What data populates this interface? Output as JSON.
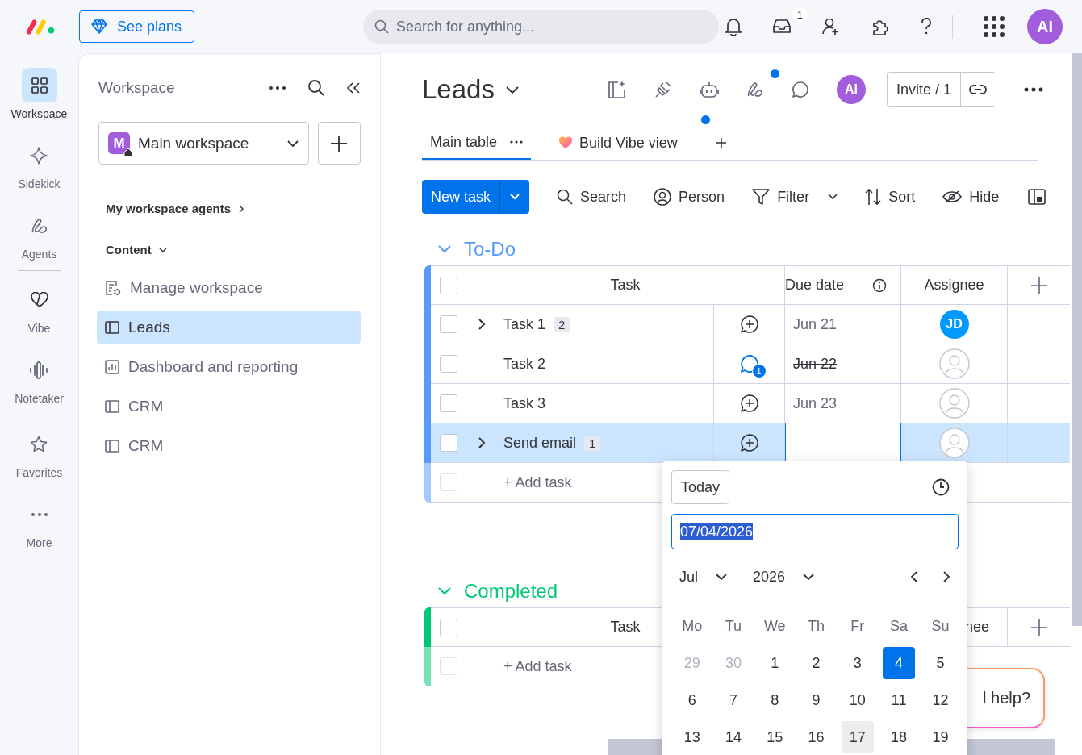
{
  "top_bar": {
    "see_plans": "See plans",
    "search": {
      "placeholder": "Search for anything..."
    },
    "inbox_badge": "1",
    "avatar": "AI"
  },
  "rail": {
    "groups": [
      {
        "items": [
          {
            "kind": "workspace",
            "label": "Workspace",
            "selected": true
          },
          {
            "kind": "sidekick",
            "label": "Sidekick",
            "selected": false
          },
          {
            "kind": "agents",
            "label": "Agents",
            "selected": false
          }
        ]
      },
      {
        "items": [
          {
            "kind": "vibe",
            "label": "Vibe",
            "selected": false
          },
          {
            "kind": "notetaker",
            "label": "Notetaker",
            "selected": false
          }
        ]
      },
      {
        "items": [
          {
            "kind": "favorites",
            "label": "Favorites",
            "selected": false
          },
          {
            "kind": "more",
            "label": "More",
            "selected": false
          }
        ]
      }
    ]
  },
  "workspace_panel": {
    "title": "Workspace",
    "selector": {
      "letter": "M",
      "name": "Main workspace"
    },
    "agents_link": "My workspace agents",
    "section": "Content",
    "items": [
      {
        "kind": "settings",
        "label": "Manage workspace",
        "selected": false
      },
      {
        "kind": "board",
        "label": "Leads",
        "selected": true
      },
      {
        "kind": "dashboard",
        "label": "Dashboard and reporting",
        "selected": false
      },
      {
        "kind": "board",
        "label": "CRM",
        "selected": false
      },
      {
        "kind": "board",
        "label": "CRM",
        "selected": false
      }
    ]
  },
  "board": {
    "title": "Leads",
    "agents_dot": true,
    "avatar": "AI",
    "invite": "Invite / 1",
    "views": [
      {
        "label": "Main table",
        "selected": true,
        "dot": false
      },
      {
        "label": "Build Vibe view",
        "selected": false,
        "dot": true
      }
    ],
    "new_task": "New task",
    "actions": [
      {
        "kind": "search",
        "label": "Search"
      },
      {
        "kind": "person",
        "label": "Person"
      },
      {
        "kind": "filter",
        "label": "Filter"
      },
      {
        "kind": "sort",
        "label": "Sort"
      },
      {
        "kind": "hide",
        "label": "Hide"
      }
    ]
  },
  "groups": [
    {
      "title": "To-Do",
      "color": "#579bfc",
      "columns": {
        "task": "Task",
        "due": "Due date",
        "assignee": "Assignee"
      },
      "all_checked": false,
      "add_checkbox_disabled": true,
      "rows": [
        {
          "task": "Task 1",
          "subitems": "2",
          "comments": "",
          "due": "Jun 21",
          "due_done": false,
          "assignee": "JD",
          "checked": false,
          "selected": false
        },
        {
          "task": "Task 2",
          "subitems": "",
          "comments": "1",
          "due": "Jun 22",
          "due_done": true,
          "assignee": "",
          "checked": false,
          "selected": false
        },
        {
          "task": "Task 3",
          "subitems": "",
          "comments": "",
          "due": "Jun 23",
          "due_done": false,
          "assignee": "",
          "checked": false,
          "selected": false
        },
        {
          "task": "Send email",
          "subitems": "1",
          "comments": "",
          "assignee": "",
          "checked": false,
          "selected": true
        }
      ],
      "add_task": "+ Add task"
    },
    {
      "title": "Completed",
      "color": "#00c875",
      "columns": {
        "task": "Task",
        "assignee": "nee"
      },
      "all_checked": false,
      "add_checkbox_disabled": true,
      "add_task": "+ Add task"
    }
  ],
  "date_picker": {
    "today": "Today",
    "value": "07/04/2026",
    "month": "Jul",
    "year": "2026",
    "weekdays": [
      "Mo",
      "Tu",
      "We",
      "Th",
      "Fr",
      "Sa",
      "Su"
    ],
    "weeks": [
      [
        {
          "label": "29",
          "outside": true,
          "selected": false,
          "hovered": false
        },
        {
          "label": "30",
          "outside": true,
          "selected": false,
          "hovered": false
        },
        {
          "label": "1",
          "outside": false,
          "selected": false,
          "hovered": false
        },
        {
          "label": "2",
          "outside": false,
          "selected": false,
          "hovered": false
        },
        {
          "label": "3",
          "outside": false,
          "selected": false,
          "hovered": false
        },
        {
          "label": "4",
          "outside": false,
          "selected": true,
          "hovered": false
        },
        {
          "label": "5",
          "outside": false,
          "selected": false,
          "hovered": false
        }
      ],
      [
        {
          "label": "6",
          "outside": false,
          "selected": false,
          "hovered": false
        },
        {
          "label": "7",
          "outside": false,
          "selected": false,
          "hovered": false
        },
        {
          "label": "8",
          "outside": false,
          "selected": false,
          "hovered": false
        },
        {
          "label": "9",
          "outside": false,
          "selected": false,
          "hovered": false
        },
        {
          "label": "10",
          "outside": false,
          "selected": false,
          "hovered": false
        },
        {
          "label": "11",
          "outside": false,
          "selected": false,
          "hovered": false
        },
        {
          "label": "12",
          "outside": false,
          "selected": false,
          "hovered": false
        }
      ],
      [
        {
          "label": "13",
          "outside": false,
          "selected": false,
          "hovered": false
        },
        {
          "label": "14",
          "outside": false,
          "selected": false,
          "hovered": false
        },
        {
          "label": "15",
          "outside": false,
          "selected": false,
          "hovered": false
        },
        {
          "label": "16",
          "outside": false,
          "selected": false,
          "hovered": false
        },
        {
          "label": "17",
          "outside": false,
          "selected": false,
          "hovered": true
        },
        {
          "label": "18",
          "outside": false,
          "selected": false,
          "hovered": false
        },
        {
          "label": "19",
          "outside": false,
          "selected": false,
          "hovered": false
        }
      ]
    ]
  },
  "help_bubble": "l help?"
}
